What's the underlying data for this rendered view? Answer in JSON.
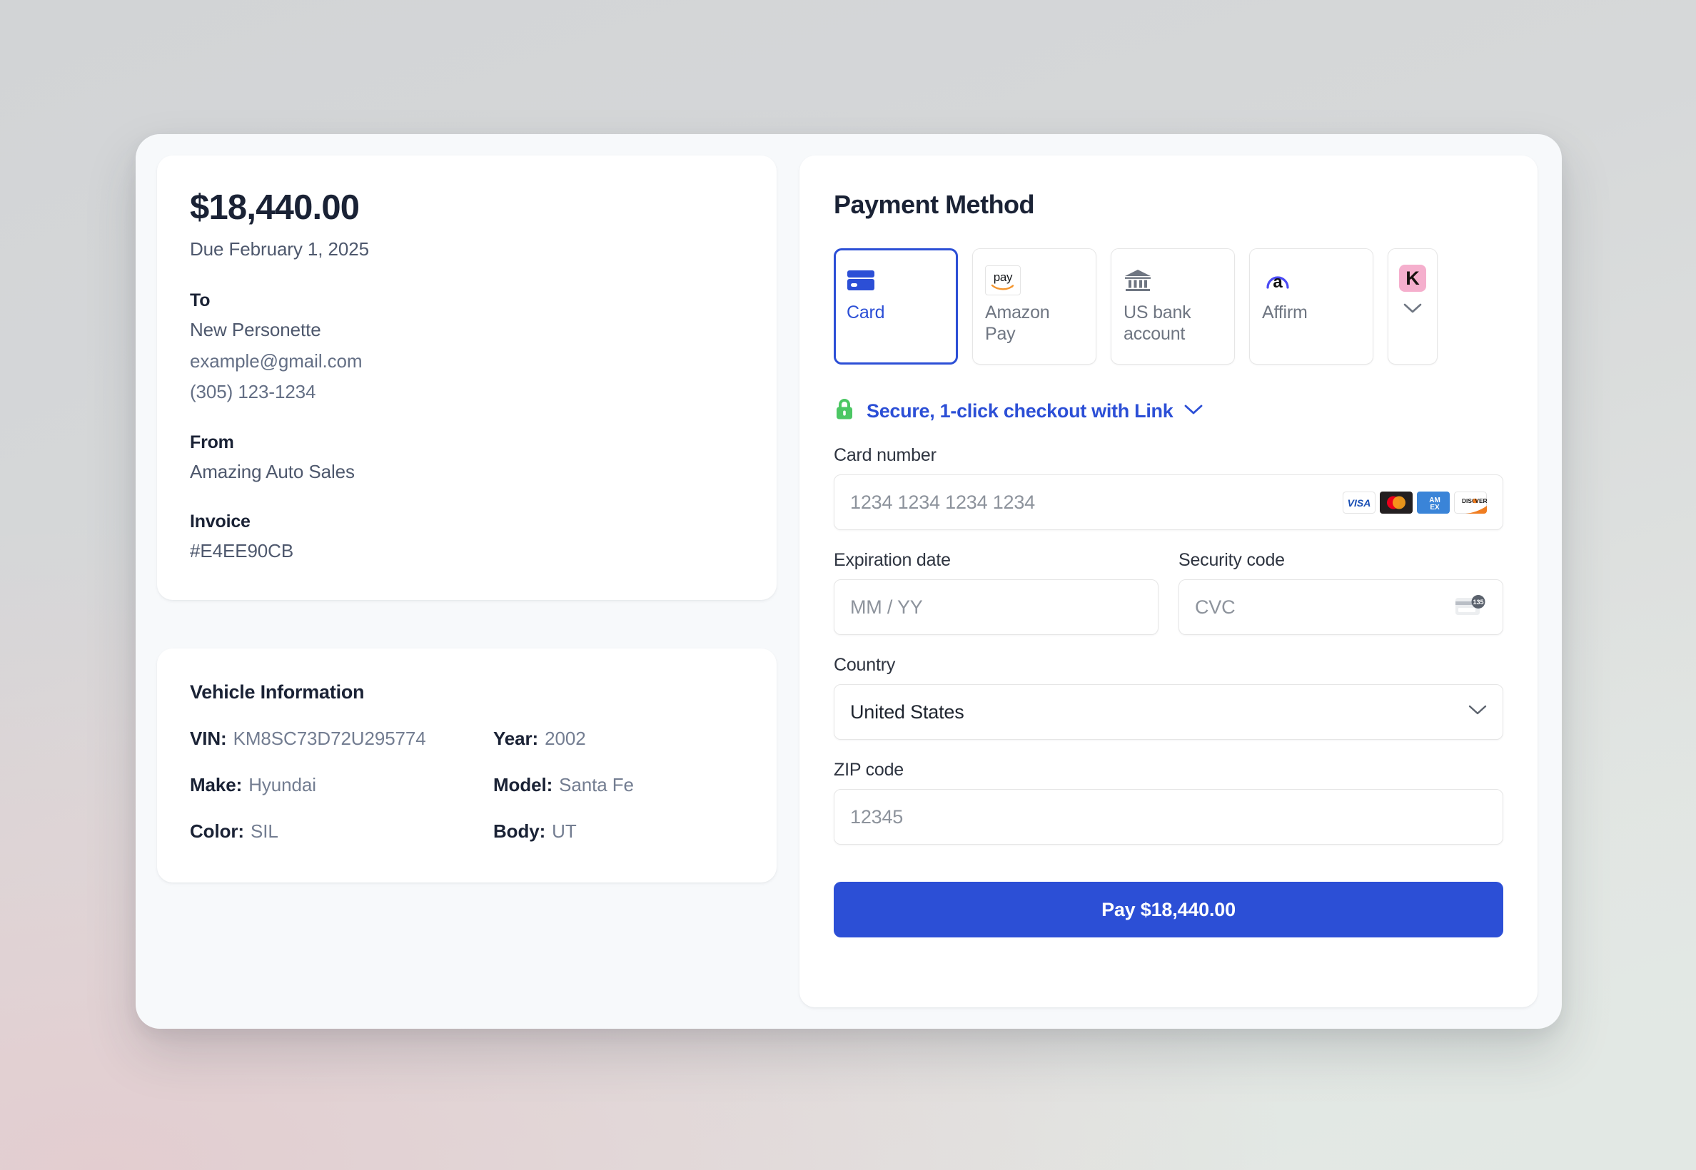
{
  "invoice": {
    "amount": "$18,440.00",
    "due": "Due February 1, 2025",
    "to_label": "To",
    "to_name": "New Personette",
    "to_email": "example@gmail.com",
    "to_phone": "(305) 123-1234",
    "from_label": "From",
    "from_name": "Amazing Auto Sales",
    "invoice_label": "Invoice",
    "invoice_number": "#E4EE90CB"
  },
  "vehicle": {
    "title": "Vehicle Information",
    "fields": [
      {
        "key": "VIN:",
        "value": "KM8SC73D72U295774"
      },
      {
        "key": "Year:",
        "value": "2002"
      },
      {
        "key": "Make:",
        "value": "Hyundai"
      },
      {
        "key": "Model:",
        "value": "Santa Fe"
      },
      {
        "key": "Color:",
        "value": "SIL"
      },
      {
        "key": "Body:",
        "value": "UT"
      }
    ]
  },
  "payment": {
    "title": "Payment Method",
    "tabs": [
      {
        "label": "Card",
        "icon": "credit-card-icon",
        "selected": true
      },
      {
        "label": "Amazon Pay",
        "icon": "amazon-pay-icon",
        "selected": false
      },
      {
        "label": "US bank account",
        "icon": "bank-icon",
        "selected": false
      },
      {
        "label": "Affirm",
        "icon": "affirm-icon",
        "selected": false
      }
    ],
    "more_tab": {
      "icon": "klarna-icon",
      "badge_letter": "K",
      "chevron": "chevron-down-icon"
    },
    "amazon_pay_mark": "pay",
    "link_banner": {
      "icon": "green-lock-icon",
      "text": "Secure, 1-click checkout with Link",
      "chevron": "chevron-down-icon"
    },
    "card_number": {
      "label": "Card number",
      "placeholder": "1234 1234 1234 1234",
      "brands": [
        "visa-icon",
        "mastercard-icon",
        "amex-icon",
        "discover-icon"
      ]
    },
    "expiration": {
      "label": "Expiration date",
      "placeholder": "MM / YY"
    },
    "security_code": {
      "label": "Security code",
      "placeholder": "CVC",
      "icon": "cvc-card-icon",
      "icon_digits": "135"
    },
    "country": {
      "label": "Country",
      "value": "United States",
      "chevron": "chevron-down-icon"
    },
    "zip": {
      "label": "ZIP code",
      "placeholder": "12345"
    },
    "pay_button": "Pay $18,440.00"
  },
  "colors": {
    "accent_blue": "#2c4fd6",
    "lock_green": "#4cc764",
    "klarna_pink": "#f5afcd",
    "text_dark": "#1a2235",
    "text_muted": "#737d91"
  }
}
